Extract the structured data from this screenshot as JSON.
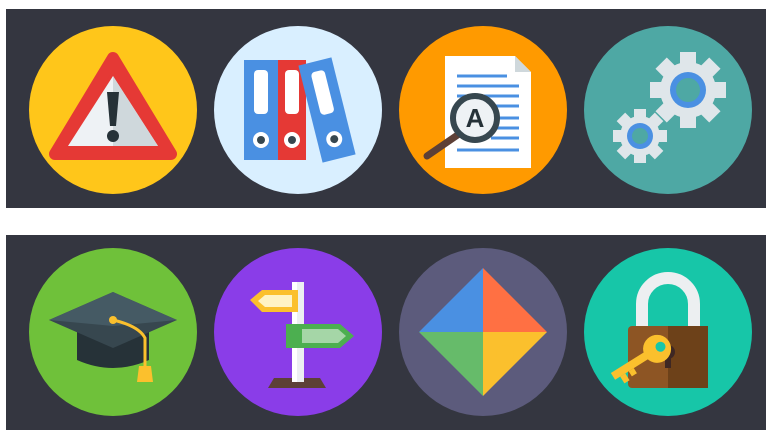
{
  "panels": {
    "top": {
      "icons": [
        "warning-icon",
        "binders-icon",
        "document-search-icon",
        "gears-icon"
      ]
    },
    "bottom": {
      "icons": [
        "graduation-cap-icon",
        "signpost-icon",
        "puzzle-icon",
        "padlock-key-icon"
      ]
    }
  },
  "colors": {
    "strip_background": "#343640",
    "warning_bg": "#ffc61a",
    "binders_bg": "#d9efff",
    "document_bg": "#ff9a00",
    "gears_bg": "#4ea8a4",
    "graduation_bg": "#6fc13a",
    "signpost_bg": "#8a3de8",
    "puzzle_bg": "#5c5b7c",
    "padlock_bg": "#17c6a8"
  },
  "document_icon": {
    "magnifier_letter": "A"
  }
}
